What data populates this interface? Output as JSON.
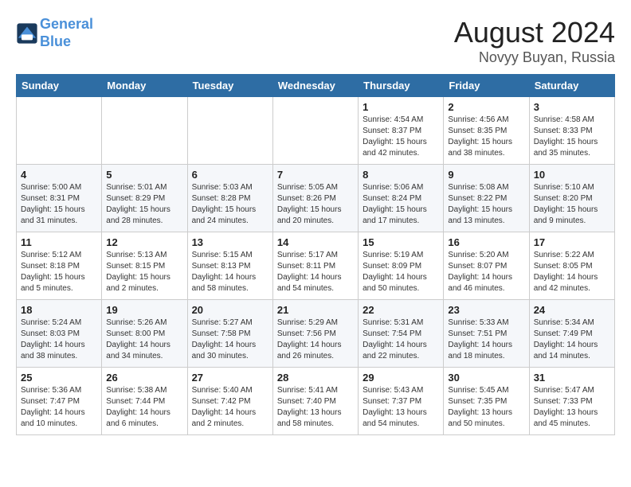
{
  "header": {
    "logo_line1": "General",
    "logo_line2": "Blue",
    "month_year": "August 2024",
    "location": "Novyy Buyan, Russia"
  },
  "days_of_week": [
    "Sunday",
    "Monday",
    "Tuesday",
    "Wednesday",
    "Thursday",
    "Friday",
    "Saturday"
  ],
  "weeks": [
    [
      {
        "day": "",
        "info": ""
      },
      {
        "day": "",
        "info": ""
      },
      {
        "day": "",
        "info": ""
      },
      {
        "day": "",
        "info": ""
      },
      {
        "day": "1",
        "info": "Sunrise: 4:54 AM\nSunset: 8:37 PM\nDaylight: 15 hours\nand 42 minutes."
      },
      {
        "day": "2",
        "info": "Sunrise: 4:56 AM\nSunset: 8:35 PM\nDaylight: 15 hours\nand 38 minutes."
      },
      {
        "day": "3",
        "info": "Sunrise: 4:58 AM\nSunset: 8:33 PM\nDaylight: 15 hours\nand 35 minutes."
      }
    ],
    [
      {
        "day": "4",
        "info": "Sunrise: 5:00 AM\nSunset: 8:31 PM\nDaylight: 15 hours\nand 31 minutes."
      },
      {
        "day": "5",
        "info": "Sunrise: 5:01 AM\nSunset: 8:29 PM\nDaylight: 15 hours\nand 28 minutes."
      },
      {
        "day": "6",
        "info": "Sunrise: 5:03 AM\nSunset: 8:28 PM\nDaylight: 15 hours\nand 24 minutes."
      },
      {
        "day": "7",
        "info": "Sunrise: 5:05 AM\nSunset: 8:26 PM\nDaylight: 15 hours\nand 20 minutes."
      },
      {
        "day": "8",
        "info": "Sunrise: 5:06 AM\nSunset: 8:24 PM\nDaylight: 15 hours\nand 17 minutes."
      },
      {
        "day": "9",
        "info": "Sunrise: 5:08 AM\nSunset: 8:22 PM\nDaylight: 15 hours\nand 13 minutes."
      },
      {
        "day": "10",
        "info": "Sunrise: 5:10 AM\nSunset: 8:20 PM\nDaylight: 15 hours\nand 9 minutes."
      }
    ],
    [
      {
        "day": "11",
        "info": "Sunrise: 5:12 AM\nSunset: 8:18 PM\nDaylight: 15 hours\nand 5 minutes."
      },
      {
        "day": "12",
        "info": "Sunrise: 5:13 AM\nSunset: 8:15 PM\nDaylight: 15 hours\nand 2 minutes."
      },
      {
        "day": "13",
        "info": "Sunrise: 5:15 AM\nSunset: 8:13 PM\nDaylight: 14 hours\nand 58 minutes."
      },
      {
        "day": "14",
        "info": "Sunrise: 5:17 AM\nSunset: 8:11 PM\nDaylight: 14 hours\nand 54 minutes."
      },
      {
        "day": "15",
        "info": "Sunrise: 5:19 AM\nSunset: 8:09 PM\nDaylight: 14 hours\nand 50 minutes."
      },
      {
        "day": "16",
        "info": "Sunrise: 5:20 AM\nSunset: 8:07 PM\nDaylight: 14 hours\nand 46 minutes."
      },
      {
        "day": "17",
        "info": "Sunrise: 5:22 AM\nSunset: 8:05 PM\nDaylight: 14 hours\nand 42 minutes."
      }
    ],
    [
      {
        "day": "18",
        "info": "Sunrise: 5:24 AM\nSunset: 8:03 PM\nDaylight: 14 hours\nand 38 minutes."
      },
      {
        "day": "19",
        "info": "Sunrise: 5:26 AM\nSunset: 8:00 PM\nDaylight: 14 hours\nand 34 minutes."
      },
      {
        "day": "20",
        "info": "Sunrise: 5:27 AM\nSunset: 7:58 PM\nDaylight: 14 hours\nand 30 minutes."
      },
      {
        "day": "21",
        "info": "Sunrise: 5:29 AM\nSunset: 7:56 PM\nDaylight: 14 hours\nand 26 minutes."
      },
      {
        "day": "22",
        "info": "Sunrise: 5:31 AM\nSunset: 7:54 PM\nDaylight: 14 hours\nand 22 minutes."
      },
      {
        "day": "23",
        "info": "Sunrise: 5:33 AM\nSunset: 7:51 PM\nDaylight: 14 hours\nand 18 minutes."
      },
      {
        "day": "24",
        "info": "Sunrise: 5:34 AM\nSunset: 7:49 PM\nDaylight: 14 hours\nand 14 minutes."
      }
    ],
    [
      {
        "day": "25",
        "info": "Sunrise: 5:36 AM\nSunset: 7:47 PM\nDaylight: 14 hours\nand 10 minutes."
      },
      {
        "day": "26",
        "info": "Sunrise: 5:38 AM\nSunset: 7:44 PM\nDaylight: 14 hours\nand 6 minutes."
      },
      {
        "day": "27",
        "info": "Sunrise: 5:40 AM\nSunset: 7:42 PM\nDaylight: 14 hours\nand 2 minutes."
      },
      {
        "day": "28",
        "info": "Sunrise: 5:41 AM\nSunset: 7:40 PM\nDaylight: 13 hours\nand 58 minutes."
      },
      {
        "day": "29",
        "info": "Sunrise: 5:43 AM\nSunset: 7:37 PM\nDaylight: 13 hours\nand 54 minutes."
      },
      {
        "day": "30",
        "info": "Sunrise: 5:45 AM\nSunset: 7:35 PM\nDaylight: 13 hours\nand 50 minutes."
      },
      {
        "day": "31",
        "info": "Sunrise: 5:47 AM\nSunset: 7:33 PM\nDaylight: 13 hours\nand 45 minutes."
      }
    ]
  ]
}
